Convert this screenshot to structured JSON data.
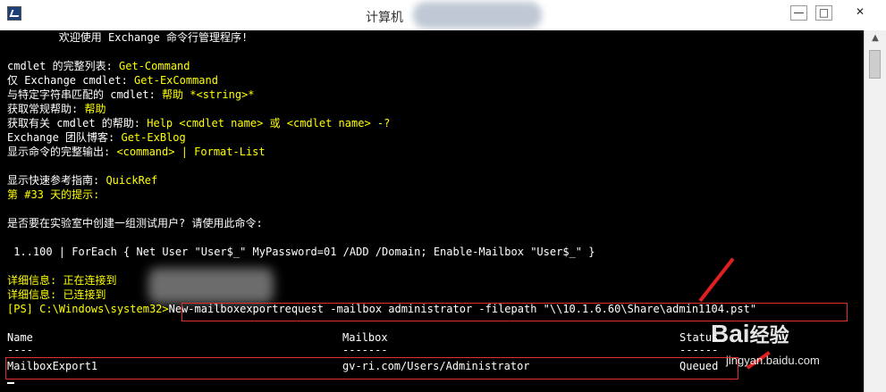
{
  "window": {
    "title": "计算机",
    "min_label": "—",
    "max_label": "□",
    "close_label": "✕"
  },
  "console": {
    "welcome": "        欢迎使用 Exchange 命令行管理程序!",
    "l1_a": "cmdlet 的完整列表: ",
    "l1_b": "Get-Command",
    "l2_a": "仅 Exchange cmdlet: ",
    "l2_b": "Get-ExCommand",
    "l3_a": "与特定字符串匹配的 cmdlet: ",
    "l3_b": "帮助 *<string>*",
    "l4_a": "获取常规帮助: ",
    "l4_b": "帮助",
    "l5_a": "获取有关 cmdlet 的帮助: ",
    "l5_b": "Help <cmdlet name> 或 <cmdlet name> -?",
    "l6_a": "Exchange 团队博客: ",
    "l6_b": "Get-ExBlog",
    "l7_a": "显示命令的完整输出: ",
    "l7_b": "<command> | Format-List",
    "l8_a": "显示快速参考指南: ",
    "l8_b": "QuickRef",
    "tip": "第 #33 天的提示:",
    "tip_body": "是否要在实验室中创建一组测试用户? 请使用此命令:",
    "tip_cmd": " 1..100 | ForEach { Net User \"User$_\" MyPassword=01 /ADD /Domain; Enable-Mailbox \"User$_\" }",
    "verbose1": "详细信息: 正在连接到",
    "verbose2": "详细信息: 已连接到",
    "prompt": "[PS] C:\\Windows\\system32>",
    "command": "New-mailboxexportrequest -mailbox administrator -filepath \"\\\\10.1.6.60\\Share\\admin1104.pst\"",
    "headers": {
      "name": "Name",
      "mailbox": "Mailbox",
      "status": "Status"
    },
    "dashes": {
      "name": "----",
      "mailbox": "-------",
      "status": "------"
    },
    "row": {
      "name": "MailboxExport1",
      "mailbox": "gv-ri.com/Users/Administrator",
      "status": "Queued"
    }
  },
  "watermark": {
    "brand": "Bai",
    "brand2": "经验",
    "url": "jingyan.baidu.com"
  },
  "colors": {
    "accent_yellow": "#ffff00",
    "highlight_red": "#e23030"
  }
}
